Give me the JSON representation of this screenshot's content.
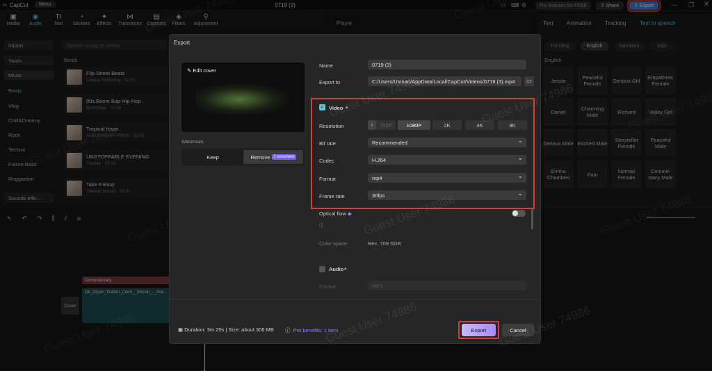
{
  "app": {
    "name": "CapCut",
    "menu_label": "Menu",
    "project_title": "0719 (3)",
    "pro_label": "Pro features for FREE",
    "share_label": "Share",
    "export_label": "Export"
  },
  "toolbar": {
    "items": [
      "Media",
      "Audio",
      "Text",
      "Stickers",
      "Effects",
      "Transitions",
      "Captions",
      "Filters",
      "Adjustment"
    ]
  },
  "leftnav": {
    "items": [
      "Import",
      "Yours",
      "Music",
      "Beats",
      "Vlog",
      "Chill&Dreamy",
      "Rock",
      "Techno",
      "Future Bass",
      "Reggaeton",
      "Sounds effe..."
    ]
  },
  "library": {
    "search_placeholder": "Search songs or artists",
    "section": "Beats",
    "items": [
      {
        "title": "Flip Street Beats",
        "meta": "Lumina Publishing · 02:15"
      },
      {
        "title": "90s Boom Bap Hip Hop",
        "meta": "BoomSage · 01:58"
      },
      {
        "title": "Tropical Haze",
        "meta": "ALEKSANDAR IVIROV · 02:03"
      },
      {
        "title": "UNSTOPPABLE EVENING",
        "meta": "Youtube · 02:15"
      },
      {
        "title": "Take It Easy",
        "meta": "Yuletide Sounds · 02:22"
      }
    ]
  },
  "player": {
    "title": "Player"
  },
  "rightpanel": {
    "tabs": [
      "Text",
      "Animation",
      "Tracking",
      "Text to speech"
    ],
    "filters": [
      "Trending",
      "English",
      "Narration",
      "Indo"
    ],
    "section": "English",
    "voices": [
      "Jessie",
      "Peaceful Female",
      "Serious Girl",
      "Empathetic Female",
      "Daniel",
      "Charming Male",
      "Richard",
      "Valley Girl",
      "Serious Male",
      "Excited Male",
      "Storyteller Female",
      "Peaceful Male",
      "Emma Chamberl",
      "Pam",
      "Normal Female",
      "Comme-ntary Male"
    ]
  },
  "timeline": {
    "track_labels": {
      "text_clip": "Documentary",
      "video_clip": "Dil_Diyan_Gallan_(Jeril__Mona)_-_Pre...",
      "cover": "Cover"
    }
  },
  "dialog": {
    "title": "Export",
    "cover": {
      "edit_label": "Edit cover"
    },
    "watermark": {
      "label": "Watermark",
      "keep": "Keep",
      "remove": "Remove",
      "uses": "2 uses/wee"
    },
    "name_label": "Name",
    "name_value": "0719 (3)",
    "export_to_label": "Export to",
    "export_to_value": "C:/Users/Usman/AppData/Local/CapCut/Videos/0719 (3).mp4",
    "video": {
      "label": "Video",
      "checked": true,
      "resolution_label": "Resolution",
      "resolutions": [
        "720P",
        "1080P",
        "2K",
        "4K",
        "8K"
      ],
      "resolution_selected": "1080P",
      "bitrate_label": "Bit rate",
      "bitrate_value": "Recommended",
      "codec_label": "Codec",
      "codec_value": "H.264",
      "format_label": "Format",
      "format_value": "mp4",
      "framerate_label": "Frame rate",
      "framerate_value": "30fps"
    },
    "optical_flow_label": "Optical flow",
    "color_space_label": "Color space",
    "color_space_value": "Rec. 709 SDR",
    "audio": {
      "label": "Audio",
      "checked": false,
      "format_label": "Format",
      "format_value": "MP3"
    },
    "footer": {
      "info": "Duration: 3m 20s | Size: about 306 MB",
      "pro_benefits": "Pro benefits: 1 item",
      "export": "Export",
      "cancel": "Cancel"
    }
  },
  "watermark_text": "Guest User 74986",
  "colors": {
    "accent": "#5fc7d6",
    "export_btn": "#b9a7ff",
    "highlight_red": "#d93a3a",
    "remove_badge": "#7b5cff"
  }
}
